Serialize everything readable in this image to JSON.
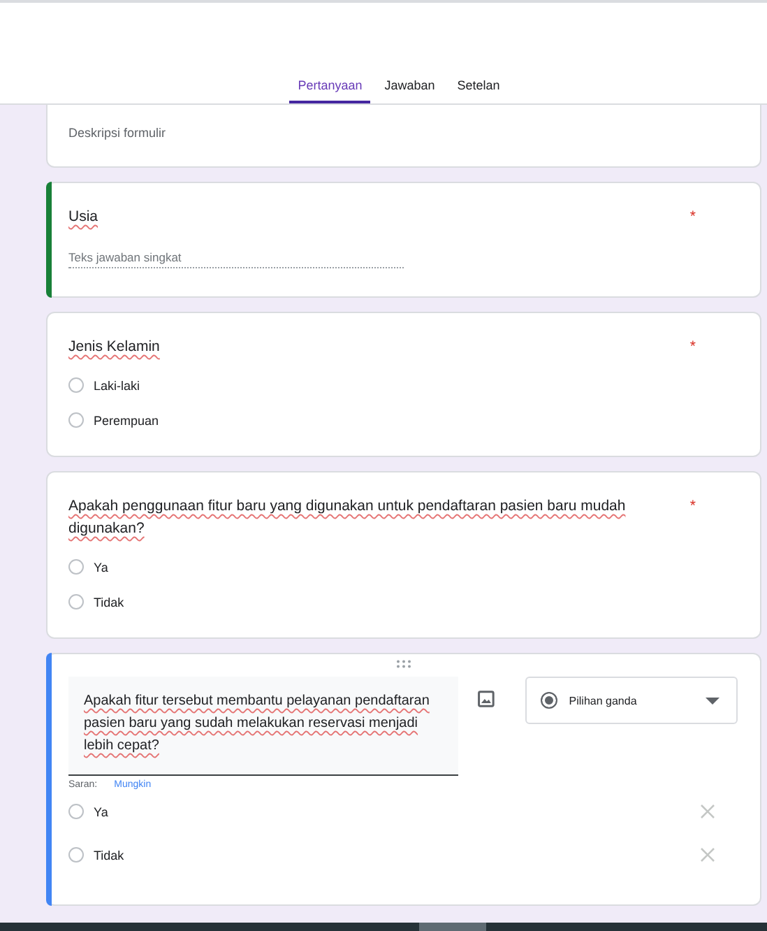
{
  "tabs": [
    {
      "label": "Pertanyaan",
      "selected": true
    },
    {
      "label": "Jawaban",
      "selected": false
    },
    {
      "label": "Setelan",
      "selected": false
    }
  ],
  "description": {
    "placeholder": "Deskripsi formulir"
  },
  "questions": [
    {
      "kind": "short",
      "title": "Usia",
      "required_mark": "*",
      "color": "#188038",
      "placeholder": "Teks jawaban singkat"
    },
    {
      "kind": "choice",
      "title": "Jenis Kelamin",
      "required_mark": "*",
      "options": [
        {
          "label": "Laki-laki",
          "selected": false
        },
        {
          "label": "Perempuan",
          "selected": false
        }
      ]
    },
    {
      "kind": "choice",
      "title": "Apakah penggunaan fitur baru yang digunakan untuk pendaftaran pasien baru mudah digunakan?",
      "required_mark": "*",
      "options": [
        {
          "label": "Ya",
          "selected": false
        },
        {
          "label": "Tidak",
          "selected": false
        }
      ]
    },
    {
      "kind": "editing",
      "title": "Apakah fitur tersebut membantu pelayanan pendaftaran pasien baru yang sudah melakukan reservasi menjadi lebih cepat?",
      "color": "#4285f4",
      "type_label": "Pilihan ganda",
      "suggestion_label": "Saran:",
      "suggestion": "Mungkin",
      "options": [
        {
          "label": "Ya",
          "selected": false
        },
        {
          "label": "Tidak",
          "selected": false
        }
      ]
    }
  ]
}
